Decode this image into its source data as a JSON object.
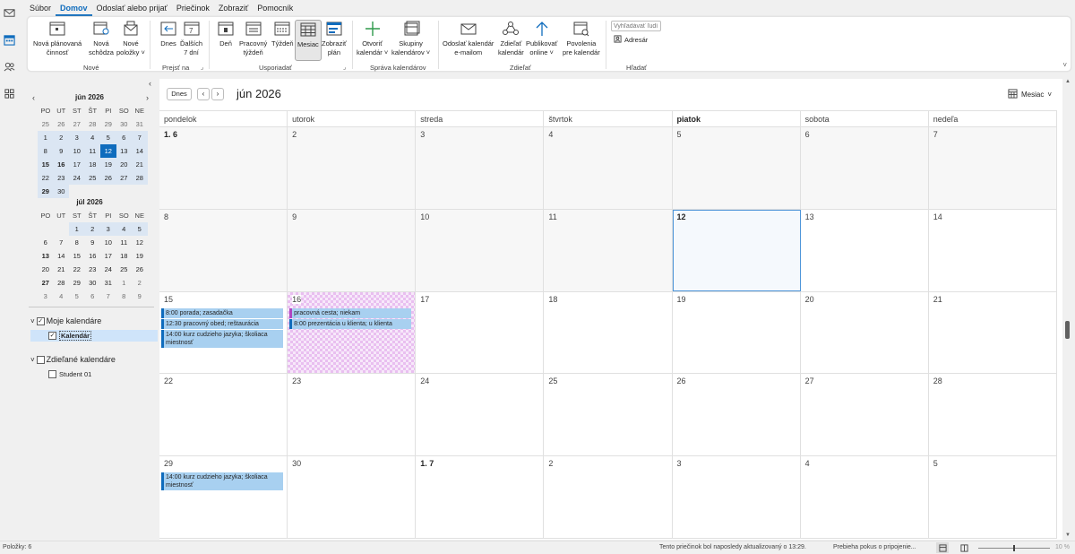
{
  "menu": {
    "tabs": [
      "Súbor",
      "Domov",
      "Odoslať alebo prijať",
      "Priečinok",
      "Zobraziť",
      "Pomocník"
    ],
    "active": "Domov"
  },
  "ribbon": {
    "groups": {
      "nove": "Nové",
      "prejst": "Prejsť na",
      "usporiadat": "Usporiadať",
      "sprava": "Správa kalendárov",
      "zdielat": "Zdieľať",
      "hladat": "Hľadať"
    },
    "buttons": {
      "nova_planovana": "Nová plánovaná\nčinnosť",
      "nova_schodza": "Nová\nschôdza",
      "nove_polozky": "Nové\npoložky ˅",
      "dnes": "Dnes",
      "dalsich7": "Ďalších\n7 dní",
      "den": "Deň",
      "pracovny_tyzden": "Pracovný\ntýždeň",
      "tyzden": "Týždeň",
      "mesiac": "Mesiac",
      "zobrazit_plan": "Zobraziť\nplán",
      "otvorit_kalendar": "Otvoriť\nkalendár ˅",
      "skupiny": "Skupiny\nkalendárov ˅",
      "odoslat_kalendar": "Odoslať kalendár\ne-mailom",
      "zdielat_kalendar": "Zdieľať\nkalendár",
      "publikovat": "Publikovať\nonline ˅",
      "povolenia": "Povolenia\npre kalendár",
      "adresar": "Adresár"
    },
    "search_placeholder": "Vyhľadávať ľudí"
  },
  "nav": {
    "mini1": {
      "title": "jún 2026",
      "dow": [
        "PO",
        "UT",
        "ST",
        "ŠT",
        "PI",
        "SO",
        "NE"
      ],
      "days": [
        [
          "25",
          "26",
          "27",
          "28",
          "29",
          "30",
          "31"
        ],
        [
          "1",
          "2",
          "3",
          "4",
          "5",
          "6",
          "7"
        ],
        [
          "8",
          "9",
          "10",
          "11",
          "12",
          "13",
          "14"
        ],
        [
          "15",
          "16",
          "17",
          "18",
          "19",
          "20",
          "21"
        ],
        [
          "22",
          "23",
          "24",
          "25",
          "26",
          "27",
          "28"
        ],
        [
          "29",
          "30",
          "",
          "",
          "",
          "",
          ""
        ]
      ]
    },
    "mini2": {
      "title": "júl 2026",
      "dow": [
        "PO",
        "UT",
        "ST",
        "ŠT",
        "PI",
        "SO",
        "NE"
      ],
      "days": [
        [
          "",
          "",
          "1",
          "2",
          "3",
          "4",
          "5"
        ],
        [
          "6",
          "7",
          "8",
          "9",
          "10",
          "11",
          "12"
        ],
        [
          "13",
          "14",
          "15",
          "16",
          "17",
          "18",
          "19"
        ],
        [
          "20",
          "21",
          "22",
          "23",
          "24",
          "25",
          "26"
        ],
        [
          "27",
          "28",
          "29",
          "30",
          "31",
          "1",
          "2"
        ],
        [
          "3",
          "4",
          "5",
          "6",
          "7",
          "8",
          "9"
        ]
      ]
    },
    "my_calendars": "Moje kalendáre",
    "calendar_item": "Kalendár",
    "shared_calendars": "Zdieľané kalendáre",
    "student": "Student 01"
  },
  "toolbar": {
    "today": "Dnes",
    "month_title": "jún 2026",
    "view": "Mesiac"
  },
  "calendar": {
    "dow": [
      "pondelok",
      "utorok",
      "streda",
      "štvrtok",
      "piatok",
      "sobota",
      "nedeľa"
    ],
    "weeks": [
      [
        "1. 6",
        "2",
        "3",
        "4",
        "5",
        "6",
        "7"
      ],
      [
        "8",
        "9",
        "10",
        "11",
        "12",
        "13",
        "14"
      ],
      [
        "15",
        "16",
        "17",
        "18",
        "19",
        "20",
        "21"
      ],
      [
        "22",
        "23",
        "24",
        "25",
        "26",
        "27",
        "28"
      ],
      [
        "29",
        "30",
        "1. 7",
        "2",
        "3",
        "4",
        "5"
      ]
    ],
    "events": {
      "e1": "8:00 porada; zasadačka",
      "e2": "12:30 pracovný obed; reštaurácia",
      "e3": "14:00 kurz cudzieho jazyka; školiaca miestnosť",
      "e4": "pracovná cesta; niekam",
      "e5": "8:00 prezentácia u klienta; u klienta",
      "e6": "14:00 kurz cudzieho jazyka; školiaca miestnosť"
    }
  },
  "status": {
    "items": "Položky: 6",
    "updated": "Tento priečinok bol naposledy aktualizovaný o 13:29.",
    "connecting": "Prebieha pokus o pripojenie...",
    "zoom": "10 %"
  }
}
